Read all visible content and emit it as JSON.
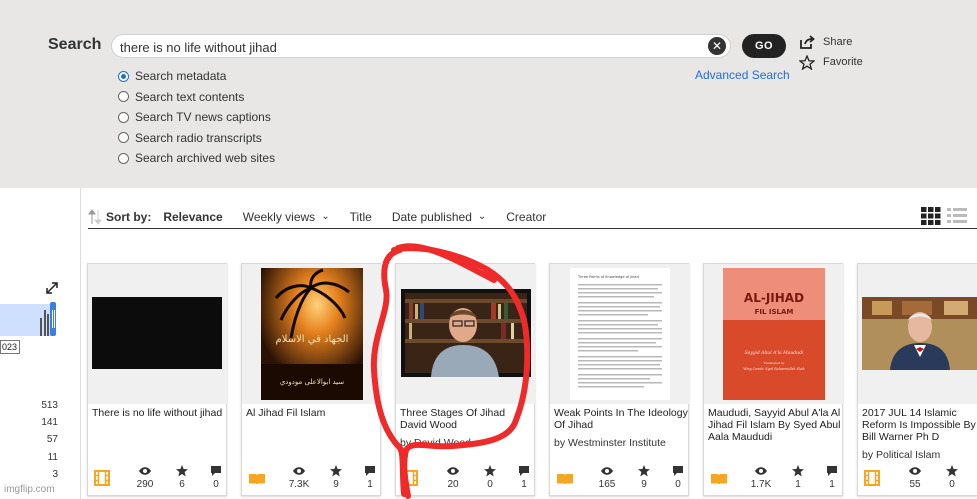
{
  "search": {
    "label": "Search",
    "query": "there is no life without jihad",
    "clear_symbol": "✕",
    "go_label": "GO",
    "advanced_label": "Advanced Search",
    "share_label": "Share",
    "favorite_label": "Favorite",
    "options": [
      {
        "label": "Search metadata",
        "checked": true
      },
      {
        "label": "Search text contents",
        "checked": false
      },
      {
        "label": "Search TV news captions",
        "checked": false
      },
      {
        "label": "Search radio transcripts",
        "checked": false
      },
      {
        "label": "Search archived web sites",
        "checked": false
      }
    ]
  },
  "sort": {
    "label": "Sort by:",
    "options": [
      {
        "label": "Relevance",
        "active": true,
        "dropdown": false
      },
      {
        "label": "Weekly views",
        "active": false,
        "dropdown": true
      },
      {
        "label": "Title",
        "active": false,
        "dropdown": false
      },
      {
        "label": "Date published",
        "active": false,
        "dropdown": true
      },
      {
        "label": "Creator",
        "active": false,
        "dropdown": false
      }
    ]
  },
  "sidebar": {
    "year_label": "023",
    "counts": [
      "513",
      "141",
      "57",
      "11",
      "3"
    ]
  },
  "watermark": "imgflip.com",
  "cards": [
    {
      "title": "There is no life without jihad",
      "creator": "",
      "type": "film",
      "views": "290",
      "favorites": "6",
      "reviews": "0"
    },
    {
      "title": "Al Jihad Fil Islam",
      "creator": "",
      "type": "book",
      "views": "7.3K",
      "favorites": "9",
      "reviews": "1"
    },
    {
      "title": "Three Stages Of Jihad David Wood",
      "creator": "by David Wood",
      "type": "film",
      "views": "20",
      "favorites": "0",
      "reviews": "1"
    },
    {
      "title": "Weak Points In The Ideology Of Jihad",
      "creator": "by Westminster Institute",
      "type": "book",
      "views": "165",
      "favorites": "9",
      "reviews": "0"
    },
    {
      "title": "Maududi, Sayyid Abul A'la Al Jihad Fil Islam By Syed Abul Aala Maududi",
      "creator": "",
      "type": "book",
      "views": "1.7K",
      "favorites": "1",
      "reviews": "1"
    },
    {
      "title": "2017 JUL 14 Islamic Reform Is Impossible By Bill Warner Ph D",
      "creator": "by Political Islam",
      "type": "film",
      "views": "55",
      "favorites": "0",
      "reviews": ""
    }
  ],
  "thumbs": {
    "book1_arabic": "الجهاد في الاسلام",
    "book1_author": "سيد ابوالاعلى مودودي",
    "book3_title": "AL-JIHAD",
    "book3_sub": "FIL ISLAM",
    "book3_author": "Sayyid Abul A'la Maududi",
    "book3_trans": "Translated by",
    "book3_trans_name": "Wing Comdr. Syed Raheemullah Shah",
    "doc_heading": "Three Points of Knowledge of Jihad"
  },
  "colors": {
    "accent_blue": "#1f6fd0",
    "panel_bg": "#e8e7e6",
    "annotation_red": "#ee2a2a",
    "type_icon_orange": "#f5a623"
  }
}
